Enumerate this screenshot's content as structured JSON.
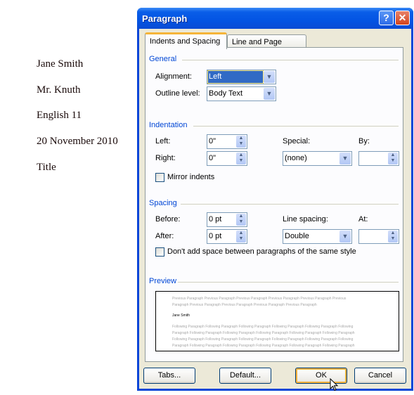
{
  "document": {
    "lines": [
      "Jane Smith",
      "Mr. Knuth",
      "English 11",
      "20 November 2010",
      "Title"
    ]
  },
  "dialog": {
    "title": "Paragraph",
    "help_icon": "question-mark-icon",
    "close_icon": "close-x-icon",
    "tabs": [
      {
        "label": "Indents and Spacing",
        "active": true
      },
      {
        "label": "Line and Page Breaks",
        "active": false
      }
    ],
    "general": {
      "heading": "General",
      "alignment_label": "Alignment:",
      "alignment_value": "Left",
      "outline_label": "Outline level:",
      "outline_value": "Body Text"
    },
    "indentation": {
      "heading": "Indentation",
      "left_label": "Left:",
      "left_value": "0\"",
      "right_label": "Right:",
      "right_value": "0\"",
      "special_label": "Special:",
      "special_value": "(none)",
      "by_label": "By:",
      "by_value": "",
      "mirror_label": "Mirror indents",
      "mirror_checked": false
    },
    "spacing": {
      "heading": "Spacing",
      "before_label": "Before:",
      "before_value": "0 pt",
      "after_label": "After:",
      "after_value": "0 pt",
      "line_spacing_label": "Line spacing:",
      "line_spacing_value": "Double",
      "at_label": "At:",
      "at_value": "",
      "dont_add_label": "Don't add space between paragraphs of the same style",
      "dont_add_checked": false
    },
    "preview": {
      "heading": "Preview",
      "previous_lines": [
        "Previous Paragraph Previous Paragraph Previous Paragraph Previous Paragraph Previous Paragraph Previous",
        "Paragraph Previous Paragraph Previous Paragraph Previous Paragraph Previous Paragraph"
      ],
      "current": "Jane Smith",
      "following_lines": [
        "Following Paragraph Following Paragraph Following Paragraph Following Paragraph Following Paragraph Following",
        "Paragraph Following Paragraph Following Paragraph Following Paragraph Following Paragraph Following Paragraph",
        "Following Paragraph Following Paragraph Following Paragraph Following Paragraph Following Paragraph Following",
        "Paragraph Following Paragraph Following Paragraph Following Paragraph Following Paragraph Following Paragraph"
      ]
    },
    "buttons": {
      "tabs": "Tabs...",
      "default": "Default...",
      "ok": "OK",
      "cancel": "Cancel"
    }
  }
}
